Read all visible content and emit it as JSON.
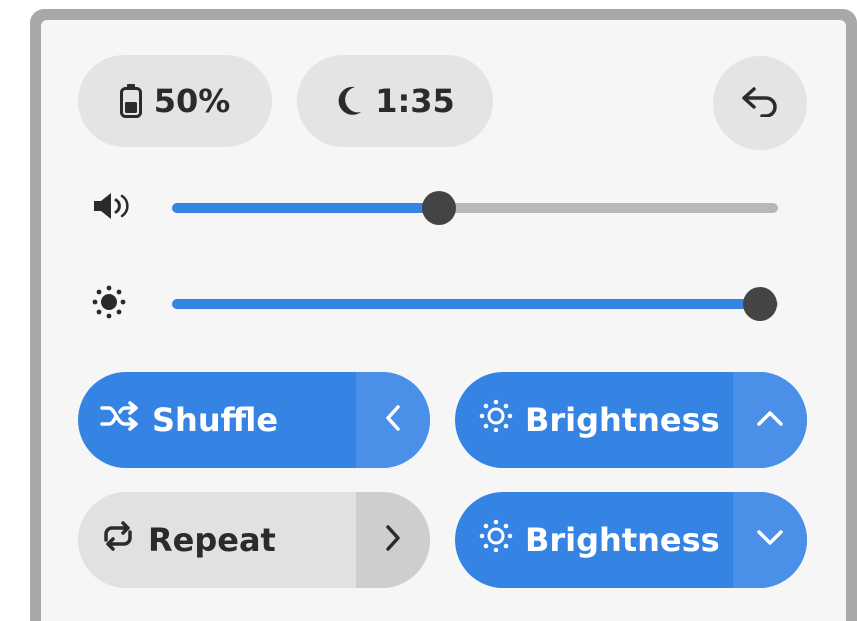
{
  "status": {
    "battery": {
      "icon": "battery-icon",
      "label": "50%"
    },
    "power_profile": {
      "icon": "moon-icon",
      "label": "1:35"
    },
    "back_button": {
      "icon": "undo-arrow-icon"
    }
  },
  "sliders": {
    "volume": {
      "icon": "speaker-icon",
      "value_percent": 44
    },
    "brightness": {
      "icon": "sun-icon",
      "value_percent": 97
    }
  },
  "toggles": [
    {
      "label": "Shuffle",
      "icon": "shuffle-icon",
      "state": "on",
      "arrow": "chevron-left-icon"
    },
    {
      "label": "Brightness",
      "icon": "sun-icon",
      "state": "on",
      "arrow": "chevron-up-icon"
    },
    {
      "label": "Repeat",
      "icon": "repeat-icon",
      "state": "off",
      "arrow": "chevron-right-icon"
    },
    {
      "label": "Brightness",
      "icon": "sun-icon",
      "state": "on",
      "arrow": "chevron-down-icon"
    }
  ],
  "colors": {
    "accent": "#3584e4",
    "panel": "#f6f6f6",
    "pill": "#e4e4e4",
    "thumb": "#444444"
  }
}
